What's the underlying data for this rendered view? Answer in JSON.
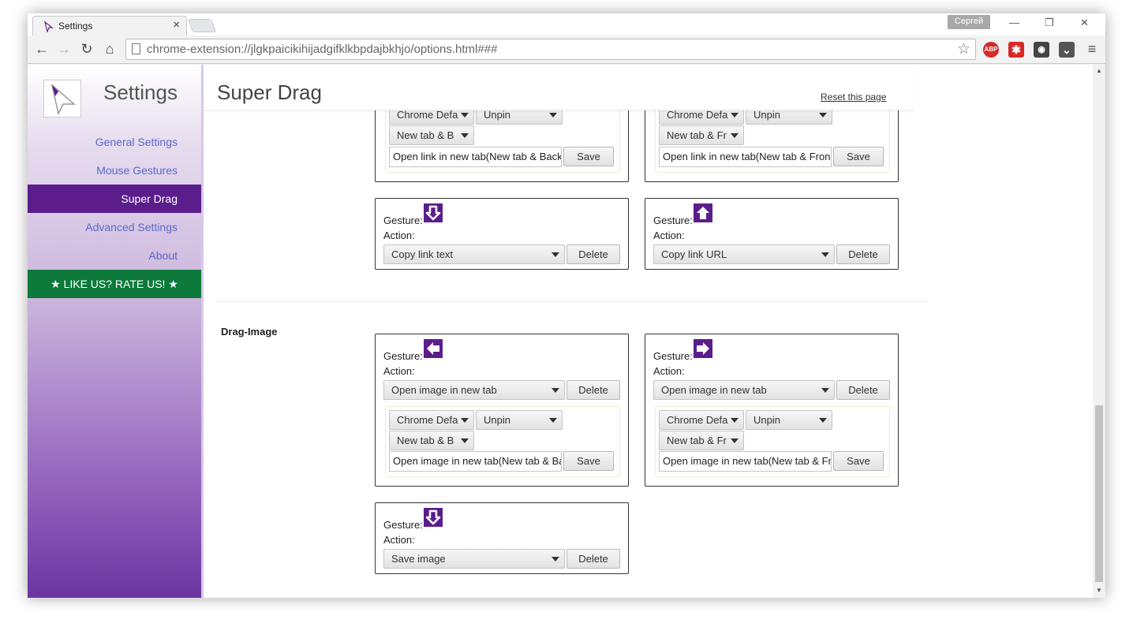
{
  "browser": {
    "tab_title": "Settings",
    "tab_close": "×",
    "user_name": "Сергей",
    "win_minimize": "—",
    "win_restore": "❐",
    "win_close": "✕",
    "back": "←",
    "forward": "→",
    "reload": "↻",
    "home": "⌂",
    "url": "chrome-extension://jlgkpaicikihijadgifklkbpdajbkhjo/options.html###",
    "star": "☆",
    "ext_abp": "ABP",
    "ext_lastpass": "✱",
    "ext_incognito": "◉",
    "ext_pocket": "⌄",
    "menu": "≡"
  },
  "sidebar": {
    "title": "Settings",
    "items": [
      {
        "label": "General Settings"
      },
      {
        "label": "Mouse Gestures"
      },
      {
        "label": "Super Drag"
      },
      {
        "label": "Advanced Settings"
      },
      {
        "label": "About"
      }
    ],
    "rate_label": "★ LIKE US? RATE US! ★"
  },
  "page": {
    "title": "Super Drag",
    "reset_label": "Reset this page",
    "section_drag_image": "Drag-Image"
  },
  "labels": {
    "gesture": "Gesture:",
    "action": "Action:",
    "delete": "Delete",
    "save": "Save"
  },
  "cards": {
    "link_partial_left": {
      "opt1": "Chrome Defa",
      "opt2": "Unpin",
      "opt3": "New tab & B",
      "name_value": "Open link in new tab(New tab & Back"
    },
    "link_partial_right": {
      "opt1": "Chrome Defa",
      "opt2": "Unpin",
      "opt3": "New tab & Fr",
      "name_value": "Open link in new tab(New tab & Fron"
    },
    "link_down": {
      "gesture_icon": "arrow-down",
      "action": "Copy link text"
    },
    "link_up": {
      "gesture_icon": "arrow-up",
      "action": "Copy link URL"
    },
    "image_left": {
      "gesture_icon": "arrow-left",
      "action": "Open image in new tab",
      "opt1": "Chrome Defa",
      "opt2": "Unpin",
      "opt3": "New tab & B",
      "name_value": "Open image in new tab(New tab & Ba"
    },
    "image_right": {
      "gesture_icon": "arrow-right",
      "action": "Open image in new tab",
      "opt1": "Chrome Defa",
      "opt2": "Unpin",
      "opt3": "New tab & Fr",
      "name_value": "Open image in new tab(New tab & Fr"
    },
    "image_down": {
      "gesture_icon": "arrow-down",
      "action": "Save image"
    }
  },
  "colors": {
    "accent_purple": "#5b1d8c",
    "rate_green": "#0d7a3c",
    "link_blue": "#5b68c9"
  }
}
